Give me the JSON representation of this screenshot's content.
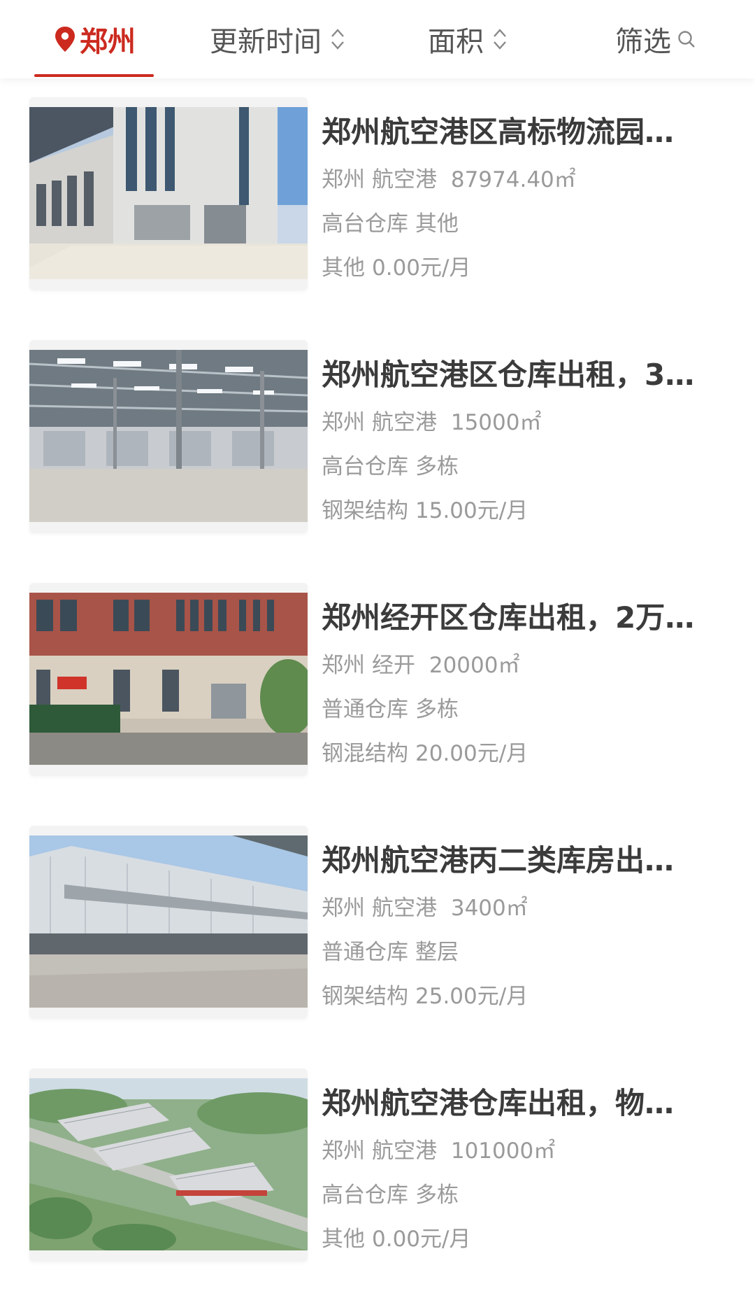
{
  "filters": {
    "location": "郑州",
    "update_time": "更新时间",
    "area": "面积",
    "filter": "筛选"
  },
  "colors": {
    "accent": "#cc2a1f",
    "title": "#3b3b3b",
    "meta": "#9a9a9a"
  },
  "listings": [
    {
      "title": "郑州航空港区高标物流园…",
      "city": "郑州",
      "district": "航空港",
      "area": "87974.40㎡",
      "type": "高台仓库",
      "floor": "其他",
      "structure": "其他",
      "price": "0.00元/月"
    },
    {
      "title": "郑州航空港区仓库出租，3…",
      "city": "郑州",
      "district": "航空港",
      "area": "15000㎡",
      "type": "高台仓库",
      "floor": "多栋",
      "structure": "钢架结构",
      "price": "15.00元/月"
    },
    {
      "title": "郑州经开区仓库出租，2万…",
      "city": "郑州",
      "district": "经开",
      "area": "20000㎡",
      "type": "普通仓库",
      "floor": "多栋",
      "structure": "钢混结构",
      "price": "20.00元/月"
    },
    {
      "title": "郑州航空港丙二类库房出…",
      "city": "郑州",
      "district": "航空港",
      "area": "3400㎡",
      "type": "普通仓库",
      "floor": "整层",
      "structure": "钢架结构",
      "price": "25.00元/月"
    },
    {
      "title": "郑州航空港仓库出租，物…",
      "city": "郑州",
      "district": "航空港",
      "area": "101000㎡",
      "type": "高台仓库",
      "floor": "多栋",
      "structure": "其他",
      "price": "0.00元/月"
    }
  ]
}
